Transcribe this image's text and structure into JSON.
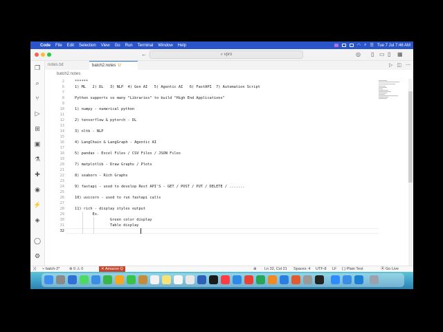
{
  "menubar": {
    "app": "Code",
    "items": [
      "File",
      "Edit",
      "Selection",
      "View",
      "Go",
      "Run",
      "Terminal",
      "Window",
      "Help"
    ],
    "clock": "Tue 7 Jul  7:46 AM"
  },
  "titlebar": {
    "search_text": "vpro"
  },
  "tabs": [
    {
      "label": "notes.txt",
      "modified": ""
    },
    {
      "label": "batch2.notes",
      "modified": "U"
    }
  ],
  "breadcrumb": "batch2.notes",
  "editor": {
    "lines": [
      {
        "n": "2",
        "text": "******"
      },
      {
        "n": "6",
        "text": "1) ML   2) DL   3) NLP  4) Gen AI   5) Agentic AI   6) FastAPI  7) Automation Script"
      },
      {
        "n": "7",
        "text": ""
      },
      {
        "n": "8",
        "text": "Python supports so many \"Libraries\" to build \"High End Applications\""
      },
      {
        "n": "9",
        "text": ""
      },
      {
        "n": "10",
        "text": "1) numpy - numerical python"
      },
      {
        "n": "11",
        "text": ""
      },
      {
        "n": "12",
        "text": "2) tensorflow & pytorch - DL"
      },
      {
        "n": "13",
        "text": ""
      },
      {
        "n": "14",
        "text": "3) nltk - NLP"
      },
      {
        "n": "15",
        "text": ""
      },
      {
        "n": "16",
        "text": "4) LangChain & LangGraph - Agentic AI"
      },
      {
        "n": "17",
        "text": ""
      },
      {
        "n": "18",
        "text": "5) pandas - Excel Files / CSV Files / JSON Files"
      },
      {
        "n": "19",
        "text": ""
      },
      {
        "n": "20",
        "text": "7) matplotlib - Draw Graphs / Plots"
      },
      {
        "n": "21",
        "text": ""
      },
      {
        "n": "22",
        "text": "8) seaborn - Rich Graphs"
      },
      {
        "n": "23",
        "text": ""
      },
      {
        "n": "24",
        "text": "9) fastapi - used to develop Rest API'S - GET / POST / PUT / DELETE / ......."
      },
      {
        "n": "25",
        "text": ""
      },
      {
        "n": "26",
        "text": "10) uvicorn - used to run fastapi calls"
      },
      {
        "n": "27",
        "text": ""
      },
      {
        "n": "28",
        "text": "11) rich - display styles output"
      },
      {
        "n": "29",
        "text": "        Ex."
      },
      {
        "n": "30",
        "text": "                Green color display"
      },
      {
        "n": "31",
        "text": "                Table display"
      },
      {
        "n": "32",
        "text": ""
      }
    ]
  },
  "statusbar": {
    "branch": "batch-2*",
    "errors": "0",
    "warnings": "0",
    "amazon_q": "Amazon Q",
    "position": "Ln 32, Col 21",
    "spaces": "Spaces: 4",
    "encoding": "UTF-8",
    "eol": "LF",
    "language": "Plain Text",
    "golive": "Go Live"
  },
  "colors": {
    "menubar": "#2a55c8",
    "accent": "#2a7adb",
    "amazon_q": "#c9462c"
  }
}
